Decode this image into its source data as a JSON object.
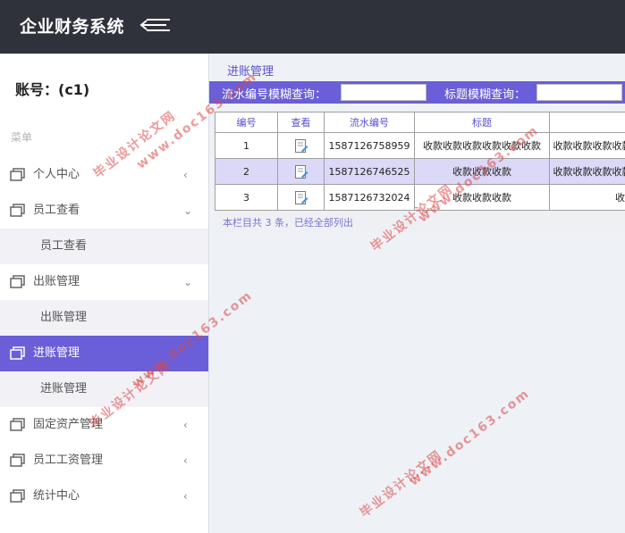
{
  "app": {
    "title": "企业财务系统"
  },
  "sidebar": {
    "account": "账号：(c1)",
    "menu_header": "菜单",
    "items": [
      {
        "label": "个人中心",
        "arrow": "‹"
      },
      {
        "label": "员工查看",
        "arrow": "⌄",
        "sub": "员工查看"
      },
      {
        "label": "出账管理",
        "arrow": "⌄",
        "sub": "出账管理"
      },
      {
        "label": "进账管理",
        "sub": "进账管理"
      },
      {
        "label": "固定资产管理",
        "arrow": "‹"
      },
      {
        "label": "员工工资管理",
        "arrow": "‹"
      },
      {
        "label": "统计中心",
        "arrow": "‹"
      }
    ]
  },
  "main": {
    "panel_title": "进账管理",
    "search": {
      "serial_label": "流水编号模糊查询：",
      "serial_value": "",
      "title_label": "标题模糊查询：",
      "title_value": ""
    },
    "table": {
      "headers": [
        "编号",
        "查看",
        "流水编号",
        "标题",
        ""
      ],
      "rows": [
        {
          "id": "1",
          "serial": "1587126758959",
          "title": "收款收款收款收款收款收款",
          "extra": "收款收款收款收款"
        },
        {
          "id": "2",
          "serial": "1587126746525",
          "title": "收款收款收款",
          "extra": "收款收款收款收款"
        },
        {
          "id": "3",
          "serial": "1587126732024",
          "title": "收款收款收款",
          "extra": "收款"
        }
      ]
    },
    "footer": "本栏目共 3 条，已经全部列出"
  },
  "watermark": {
    "site": "www.doc163.com",
    "name": "毕业设计论文网",
    "color": "#de4646"
  },
  "colors": {
    "topbar": "#2f323a",
    "accent": "#6a5fd8"
  }
}
